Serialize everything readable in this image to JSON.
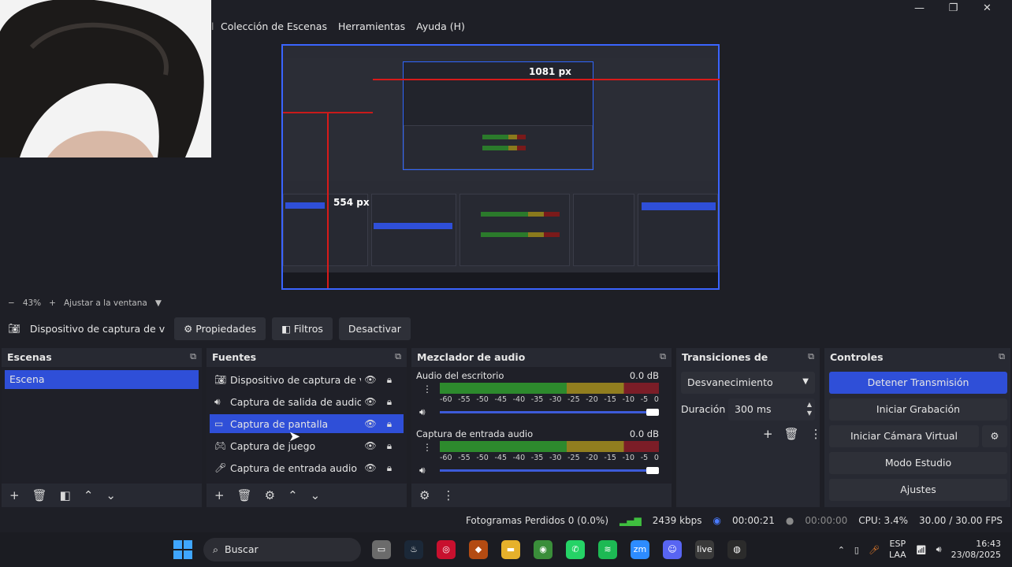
{
  "menu": [
    "Colección de Escenas",
    "Herramientas",
    "Ayuda (H)"
  ],
  "menu_left_fragment": "l",
  "window_controls": [
    "—",
    "❐",
    "✕"
  ],
  "preview": {
    "label_h": "1081 px",
    "label_v": "554 px"
  },
  "zoombar": {
    "minus": "−",
    "zoom": "43%",
    "plus": "+",
    "fit": "Ajustar a la ventana",
    "caret": "▼"
  },
  "source_toolbar": {
    "source_name": "Dispositivo de captura de v",
    "properties": "Propiedades",
    "filters": "Filtros",
    "deactivate": "Desactivar"
  },
  "docks": {
    "scenes": {
      "title": "Escenas",
      "items": [
        "Escena"
      ]
    },
    "sources": {
      "title": "Fuentes",
      "items": [
        {
          "label": "Dispositivo de captura de vide",
          "icon": "camera-icon"
        },
        {
          "label": "Captura de salida de audio",
          "icon": "speaker-icon"
        },
        {
          "label": "Captura de pantalla",
          "icon": "monitor-icon"
        },
        {
          "label": "Captura de juego",
          "icon": "gamepad-icon"
        },
        {
          "label": "Captura de entrada audio",
          "icon": "microphone-icon"
        }
      ]
    },
    "mixer": {
      "title": "Mezclador de audio",
      "channels": [
        {
          "name": "Audio del escritorio",
          "level": "0.0 dB"
        },
        {
          "name": "Captura de entrada audio",
          "level": "0.0 dB"
        }
      ],
      "ticks": [
        "-60",
        "-55",
        "-50",
        "-45",
        "-40",
        "-35",
        "-30",
        "-25",
        "-20",
        "-15",
        "-10",
        "-5",
        "0"
      ]
    },
    "transitions": {
      "title": "Transiciones de escena",
      "selected": "Desvanecimiento",
      "duration_label": "Duración",
      "duration_value": "300 ms"
    },
    "controls": {
      "title": "Controles",
      "stop_stream": "Detener Transmisión",
      "start_record": "Iniciar Grabación",
      "virtual_cam": "Iniciar Cámara Virtual",
      "studio_mode": "Modo Estudio",
      "settings": "Ajustes"
    }
  },
  "status": {
    "dropped": "Fotogramas Perdidos 0 (0.0%)",
    "bitrate": "2439 kbps",
    "stream_time": "00:00:21",
    "record_time": "00:00:00",
    "cpu": "CPU: 3.4%",
    "fps": "30.00 / 30.00 FPS"
  },
  "taskbar": {
    "search": "Buscar",
    "lang1": "ESP",
    "lang2": "LAA",
    "time": "16:43",
    "date": "23/08/2025",
    "icons": [
      {
        "name": "file-explorer-app-icon",
        "color": "#6b6b6b",
        "glyph": "▭"
      },
      {
        "name": "steam-icon",
        "color": "#1b2838",
        "glyph": "♨"
      },
      {
        "name": "red-app-icon",
        "color": "#c8102e",
        "glyph": "◎"
      },
      {
        "name": "orange-app-icon",
        "color": "#b34b12",
        "glyph": "◆"
      },
      {
        "name": "folder-icon",
        "color": "#e6b12b",
        "glyph": "▬"
      },
      {
        "name": "chrome-icon",
        "color": "#3a8e3a",
        "glyph": "◉"
      },
      {
        "name": "whatsapp-icon",
        "color": "#25d366",
        "glyph": "✆"
      },
      {
        "name": "spotify-icon",
        "color": "#1db954",
        "glyph": "≋"
      },
      {
        "name": "zoom-icon",
        "color": "#2d8cff",
        "glyph": "zm"
      },
      {
        "name": "discord-icon",
        "color": "#5865f2",
        "glyph": "☺"
      },
      {
        "name": "live-app-icon",
        "color": "#3a3a3a",
        "glyph": "live"
      },
      {
        "name": "obs-icon",
        "color": "#2b2b2b",
        "glyph": "◍"
      }
    ]
  }
}
